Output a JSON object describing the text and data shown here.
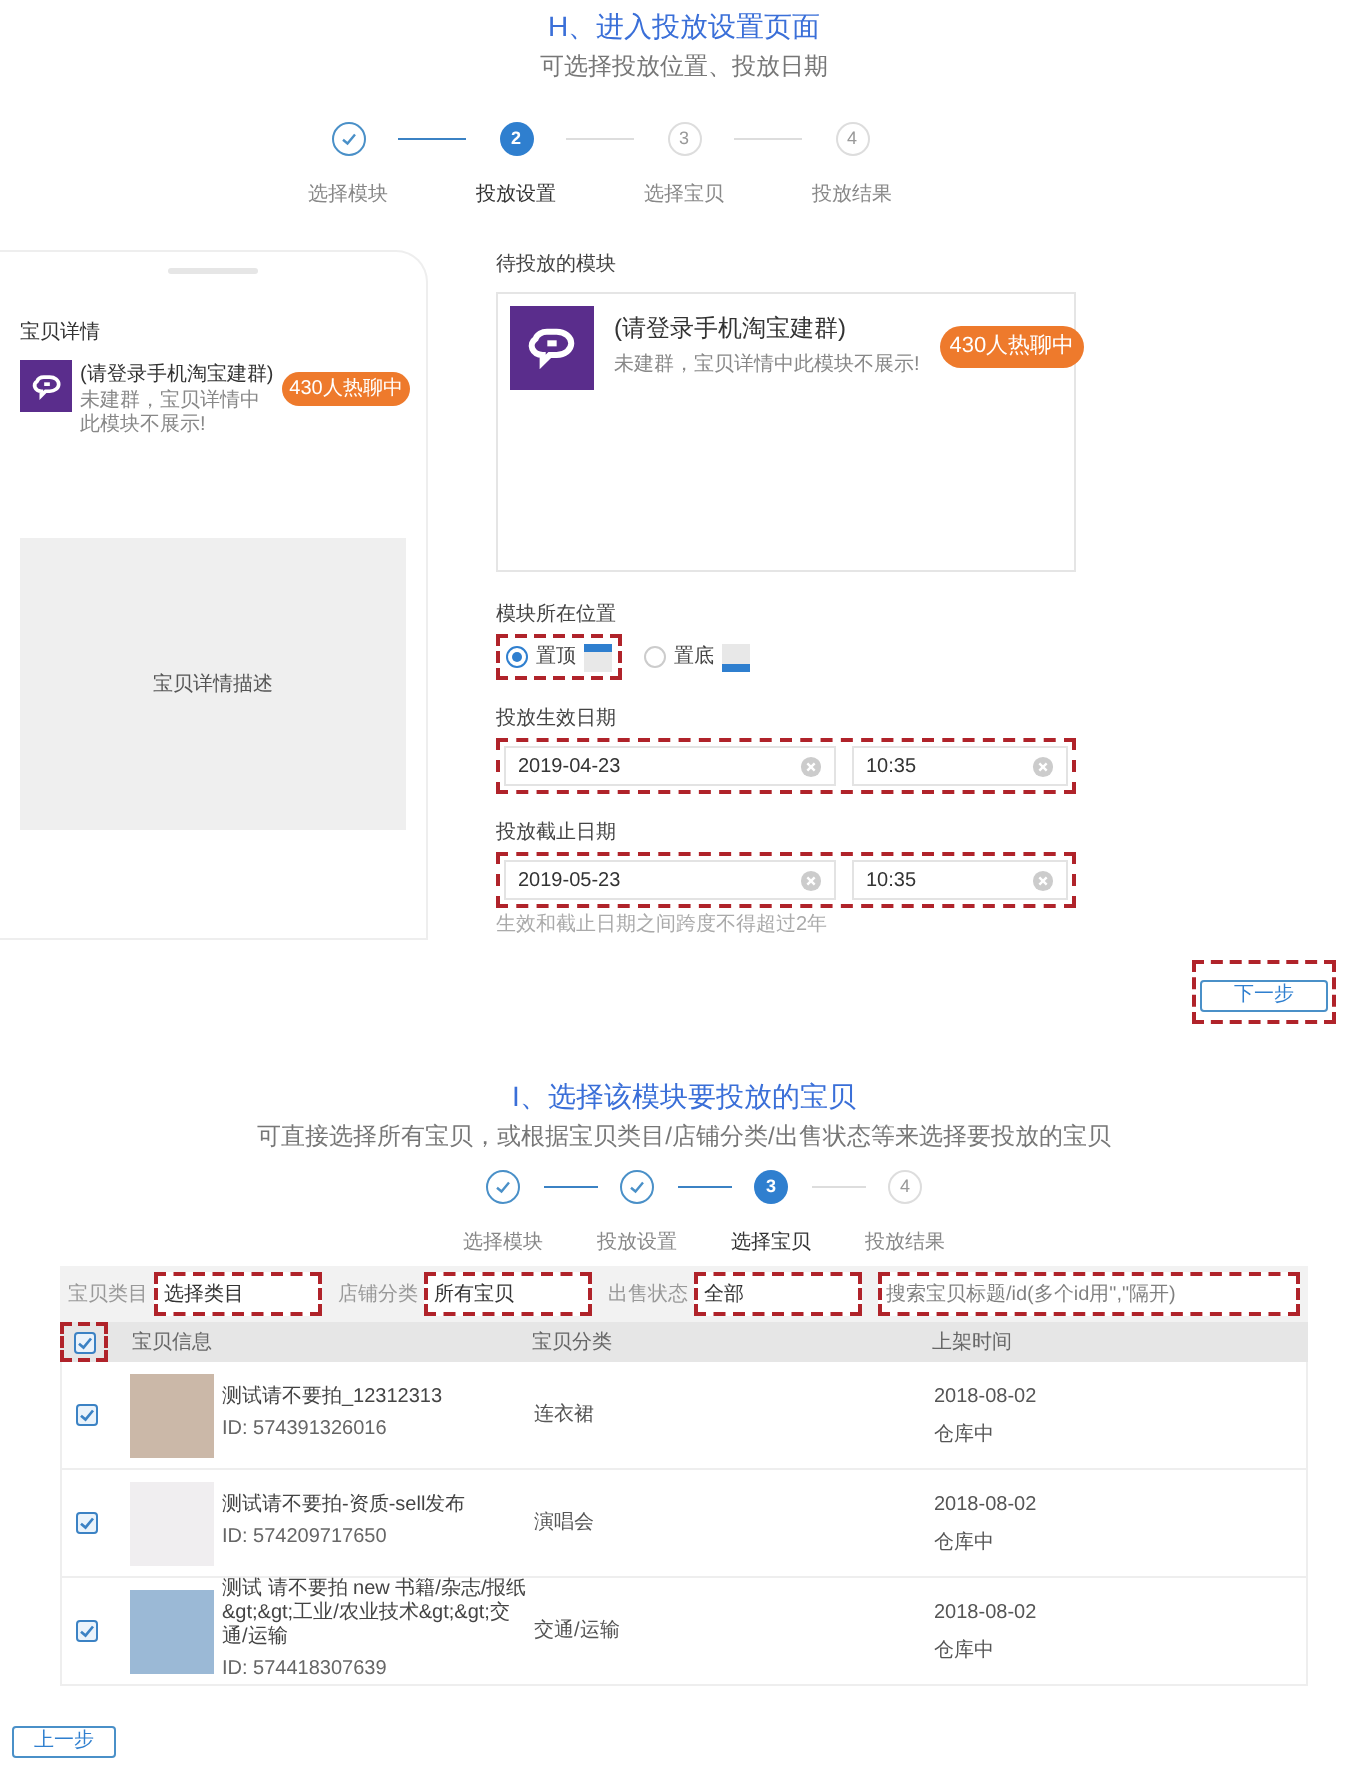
{
  "section_h": {
    "title": "H、进入投放设置页面",
    "subtitle": "可选择投放位置、投放日期",
    "steps": [
      {
        "label": "选择模块",
        "done": true,
        "selected": false
      },
      {
        "number": "2",
        "label": "投放设置",
        "done": false,
        "selected": true
      },
      {
        "number": "3",
        "label": "选择宝贝",
        "done": false,
        "selected": false
      },
      {
        "number": "4",
        "label": "投放结果",
        "done": false,
        "selected": false
      }
    ],
    "preview": {
      "section_label": "宝贝详情",
      "module_title": "(请登录手机淘宝建群)",
      "module_note": "未建群，宝贝详情中此模块不展示!",
      "badge": "430人热聊中",
      "description": "宝贝详情描述"
    },
    "form": {
      "module_label": "待投放的模块",
      "module_title": "(请登录手机淘宝建群)",
      "module_note": "未建群，宝贝详情中此模块不展示!",
      "badge": "430人热聊中",
      "position_label": "模块所在位置",
      "positions": [
        {
          "label": "置顶",
          "kind": "top",
          "selected": true,
          "highlighted": true
        },
        {
          "label": "置底",
          "kind": "bottom",
          "selected": false,
          "highlighted": false
        }
      ],
      "dates": [
        {
          "label": "投放生效日期",
          "date": "2019-04-23",
          "time": "10:35",
          "highlighted": true
        },
        {
          "label": "投放截止日期",
          "date": "2019-05-23",
          "time": "10:35",
          "highlighted": true
        }
      ],
      "hint": "生效和截止日期之间跨度不得超过2年"
    },
    "next_button": "下一步"
  },
  "section_i": {
    "title": "I、选择该模块要投放的宝贝",
    "subtitle": "可直接选择所有宝贝，或根据宝贝类目/店铺分类/出售状态等来选择要投放的宝贝",
    "steps": [
      {
        "label": "选择模块",
        "done": true,
        "selected": false
      },
      {
        "label": "投放设置",
        "done": true,
        "selected": false
      },
      {
        "number": "3",
        "label": "选择宝贝",
        "done": false,
        "selected": true
      },
      {
        "number": "4",
        "label": "投放结果",
        "done": false,
        "selected": false
      }
    ],
    "filters": [
      {
        "label": "宝贝类目",
        "value": "选择类目"
      },
      {
        "label": "店铺分类",
        "value": "所有宝贝"
      },
      {
        "label": "出售状态",
        "value": "全部"
      }
    ],
    "search": {
      "placeholder": "搜索宝贝标题/id(多个id用\",\"隔开)"
    },
    "table": {
      "select_all_checked": true,
      "columns": [
        "宝贝信息",
        "宝贝分类",
        "上架时间"
      ],
      "rows": [
        {
          "checked": true,
          "title": "测试请不要拍_12312313",
          "id": "ID: 574391326016",
          "category": "连衣裙",
          "date": "2018-08-02",
          "status": "仓库中"
        },
        {
          "checked": true,
          "title": "测试请不要拍-资质-sell发布",
          "id": "ID: 574209717650",
          "category": "演唱会",
          "date": "2018-08-02",
          "status": "仓库中"
        },
        {
          "checked": true,
          "title": "测试 请不要拍 new 书籍/杂志/报纸&gt;&gt;工业/农业技术&gt;&gt;交通/运输",
          "id": "ID: 574418307639",
          "category": "交通/运输",
          "date": "2018-08-02",
          "status": "仓库中"
        }
      ]
    },
    "prev_button": "上一步"
  }
}
